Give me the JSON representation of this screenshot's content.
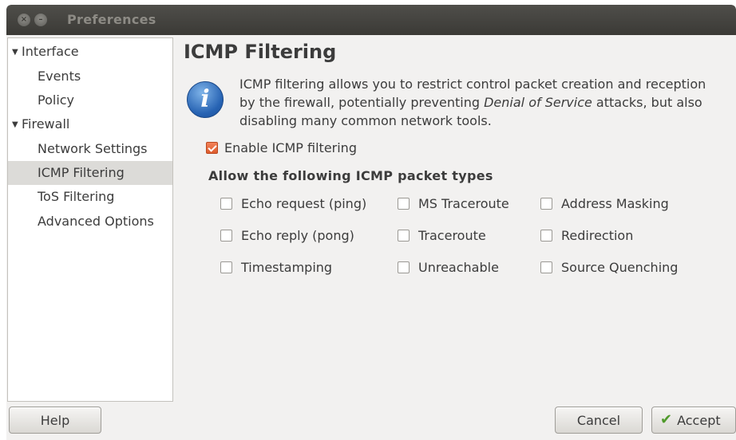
{
  "window": {
    "title": "Preferences",
    "close_glyph": "×",
    "minimize_glyph": "–"
  },
  "sidebar": {
    "items": [
      {
        "label": "Interface",
        "level": 0,
        "expanded": true
      },
      {
        "label": "Events",
        "level": 1
      },
      {
        "label": "Policy",
        "level": 1
      },
      {
        "label": "Firewall",
        "level": 0,
        "expanded": true
      },
      {
        "label": "Network Settings",
        "level": 1
      },
      {
        "label": "ICMP Filtering",
        "level": 1,
        "selected": true
      },
      {
        "label": "ToS Filtering",
        "level": 1
      },
      {
        "label": "Advanced Options",
        "level": 1
      }
    ],
    "expander_glyph": "▼"
  },
  "main": {
    "heading": "ICMP Filtering",
    "info_icon_glyph": "i",
    "info_text_1": "ICMP filtering allows you to restrict control packet creation and reception by the firewall, potentially preventing ",
    "info_text_em": "Denial of Service",
    "info_text_2": " attacks, but also disabling many common network tools.",
    "enable_label": "Enable ICMP filtering",
    "enable_checked": true,
    "allow_label": "Allow the following ICMP packet types",
    "options": [
      {
        "label": "Echo request (ping)",
        "checked": false
      },
      {
        "label": "MS Traceroute",
        "checked": false
      },
      {
        "label": "Address Masking",
        "checked": false
      },
      {
        "label": "Echo reply (pong)",
        "checked": false
      },
      {
        "label": "Traceroute",
        "checked": false
      },
      {
        "label": "Redirection",
        "checked": false
      },
      {
        "label": "Timestamping",
        "checked": false
      },
      {
        "label": "Unreachable",
        "checked": false
      },
      {
        "label": "Source Quenching",
        "checked": false
      }
    ]
  },
  "buttons": {
    "help": "Help",
    "cancel": "Cancel",
    "accept": "Accept",
    "accept_icon": "✔"
  },
  "colors": {
    "titlebar": "#3b3a36",
    "checkbox_checked": "#dd5b2c",
    "info_icon": "#2763b3",
    "selected_row": "#dcdbd8"
  }
}
